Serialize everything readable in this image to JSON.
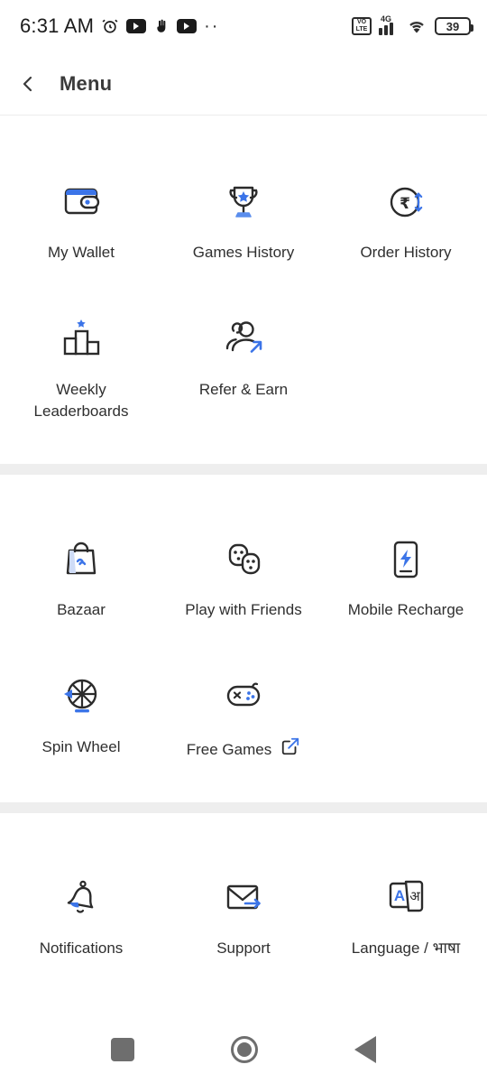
{
  "statusbar": {
    "time": "6:31 AM",
    "overflow_dots": "··",
    "volte_line1": "VO",
    "volte_line2": "LTE",
    "network": "4G",
    "battery_level": "39",
    "icons": [
      "alarm-icon",
      "youtube-icon",
      "gesture-icon",
      "youtube-icon",
      "overflow-dots-icon",
      "volte-icon",
      "signal-icon",
      "wifi-icon",
      "battery-icon"
    ]
  },
  "appbar": {
    "title": "Menu",
    "back_icon": "chevron-left-icon"
  },
  "sections": [
    {
      "id": "account",
      "items": [
        {
          "label": "My Wallet",
          "icon": "wallet-icon"
        },
        {
          "label": "Games History",
          "icon": "trophy-icon"
        },
        {
          "label": "Order History",
          "icon": "rupee-exchange-icon"
        },
        {
          "label": "Weekly Leaderboards",
          "icon": "podium-icon"
        },
        {
          "label": "Refer & Earn",
          "icon": "refer-people-icon"
        }
      ]
    },
    {
      "id": "play",
      "items": [
        {
          "label": "Bazaar",
          "icon": "shopping-bag-icon"
        },
        {
          "label": "Play with Friends",
          "icon": "dice-faces-icon"
        },
        {
          "label": "Mobile Recharge",
          "icon": "phone-bolt-icon"
        },
        {
          "label": "Spin Wheel",
          "icon": "spin-wheel-icon"
        },
        {
          "label": "Free Games",
          "icon": "gamepad-icon",
          "trailing_icon": "external-link-icon"
        }
      ]
    },
    {
      "id": "settings",
      "items": [
        {
          "label": "Notifications",
          "icon": "bell-icon"
        },
        {
          "label": "Support",
          "icon": "envelope-arrow-icon"
        },
        {
          "label": "Language / भाषा",
          "icon": "language-cards-icon"
        }
      ]
    }
  ],
  "navbar": {
    "recents_label": "Recents",
    "home_label": "Home",
    "back_label": "Back"
  },
  "colors": {
    "accent": "#3b74e8",
    "accent_light": "#6c9bf0",
    "ink": "#2f2f2f",
    "outline": "#2b2b2b",
    "divider": "#eeeeee",
    "nav_gray": "#6e6e6e"
  }
}
